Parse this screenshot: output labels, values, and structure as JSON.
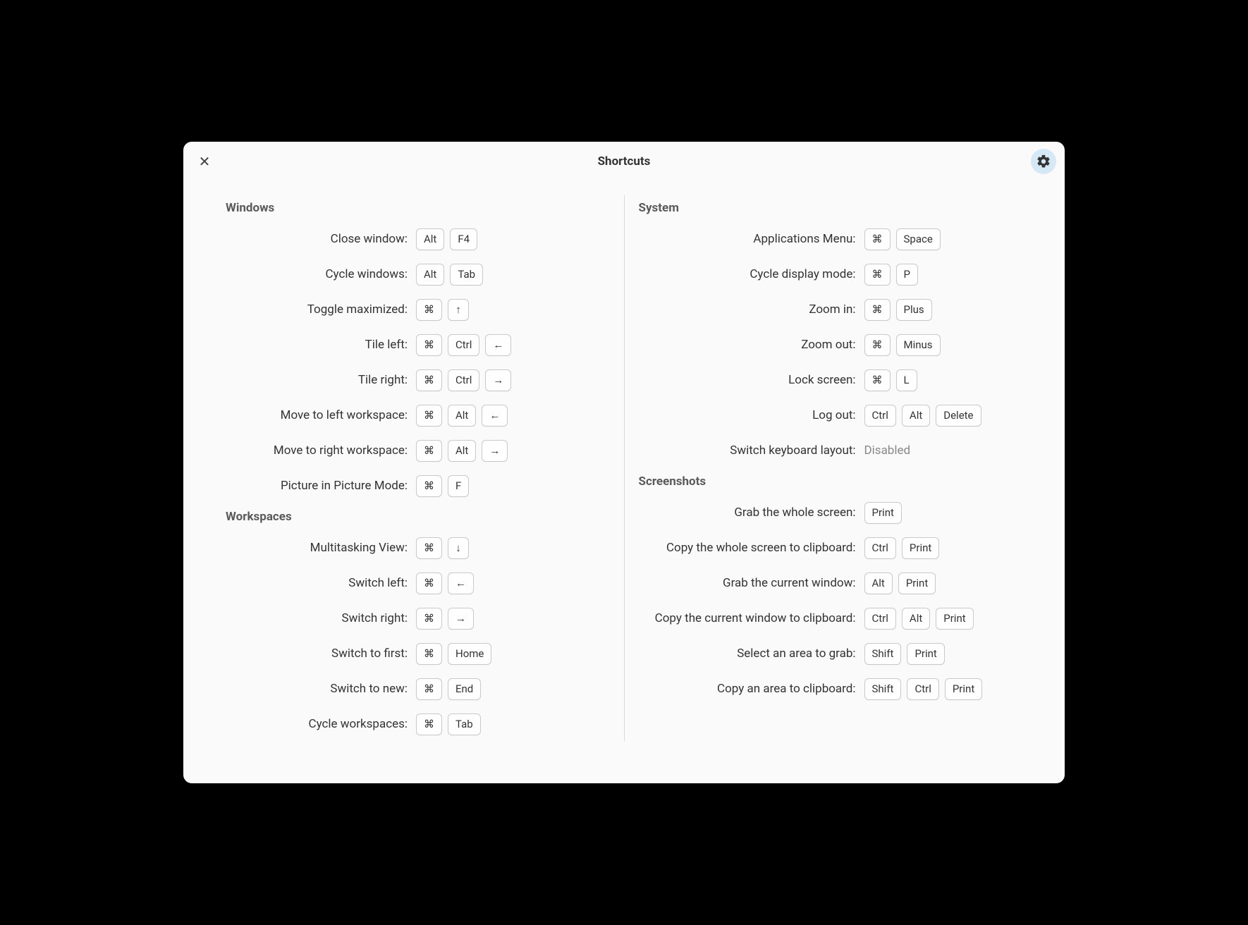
{
  "title": "Shortcuts",
  "left_column": [
    {
      "heading": "Windows",
      "rows": [
        {
          "label": "Close window:",
          "keys": [
            "Alt",
            "F4"
          ]
        },
        {
          "label": "Cycle windows:",
          "keys": [
            "Alt",
            "Tab"
          ]
        },
        {
          "label": "Toggle maximized:",
          "keys": [
            "⌘",
            "↑"
          ]
        },
        {
          "label": "Tile left:",
          "keys": [
            "⌘",
            "Ctrl",
            "←"
          ]
        },
        {
          "label": "Tile right:",
          "keys": [
            "⌘",
            "Ctrl",
            "→"
          ]
        },
        {
          "label": "Move to left workspace:",
          "keys": [
            "⌘",
            "Alt",
            "←"
          ]
        },
        {
          "label": "Move to right workspace:",
          "keys": [
            "⌘",
            "Alt",
            "→"
          ]
        },
        {
          "label": "Picture in Picture Mode:",
          "keys": [
            "⌘",
            "F"
          ]
        }
      ]
    },
    {
      "heading": "Workspaces",
      "rows": [
        {
          "label": "Multitasking View:",
          "keys": [
            "⌘",
            "↓"
          ]
        },
        {
          "label": "Switch left:",
          "keys": [
            "⌘",
            "←"
          ]
        },
        {
          "label": "Switch right:",
          "keys": [
            "⌘",
            "→"
          ]
        },
        {
          "label": "Switch to first:",
          "keys": [
            "⌘",
            "Home"
          ]
        },
        {
          "label": "Switch to new:",
          "keys": [
            "⌘",
            "End"
          ]
        },
        {
          "label": "Cycle workspaces:",
          "keys": [
            "⌘",
            "Tab"
          ]
        }
      ]
    }
  ],
  "right_column": [
    {
      "heading": "System",
      "rows": [
        {
          "label": "Applications Menu:",
          "keys": [
            "⌘",
            "Space"
          ]
        },
        {
          "label": "Cycle display mode:",
          "keys": [
            "⌘",
            "P"
          ]
        },
        {
          "label": "Zoom in:",
          "keys": [
            "⌘",
            "Plus"
          ]
        },
        {
          "label": "Zoom out:",
          "keys": [
            "⌘",
            "Minus"
          ]
        },
        {
          "label": "Lock screen:",
          "keys": [
            "⌘",
            "L"
          ]
        },
        {
          "label": "Log out:",
          "keys": [
            "Ctrl",
            "Alt",
            "Delete"
          ]
        },
        {
          "label": "Switch keyboard layout:",
          "disabled": "Disabled"
        }
      ]
    },
    {
      "heading": "Screenshots",
      "rows": [
        {
          "label": "Grab the whole screen:",
          "keys": [
            "Print"
          ]
        },
        {
          "label": "Copy the whole screen to clipboard:",
          "keys": [
            "Ctrl",
            "Print"
          ]
        },
        {
          "label": "Grab the current window:",
          "keys": [
            "Alt",
            "Print"
          ]
        },
        {
          "label": "Copy the current window to clipboard:",
          "keys": [
            "Ctrl",
            "Alt",
            "Print"
          ]
        },
        {
          "label": "Select an area to grab:",
          "keys": [
            "Shift",
            "Print"
          ]
        },
        {
          "label": "Copy an area to clipboard:",
          "keys": [
            "Shift",
            "Ctrl",
            "Print"
          ]
        }
      ]
    }
  ]
}
